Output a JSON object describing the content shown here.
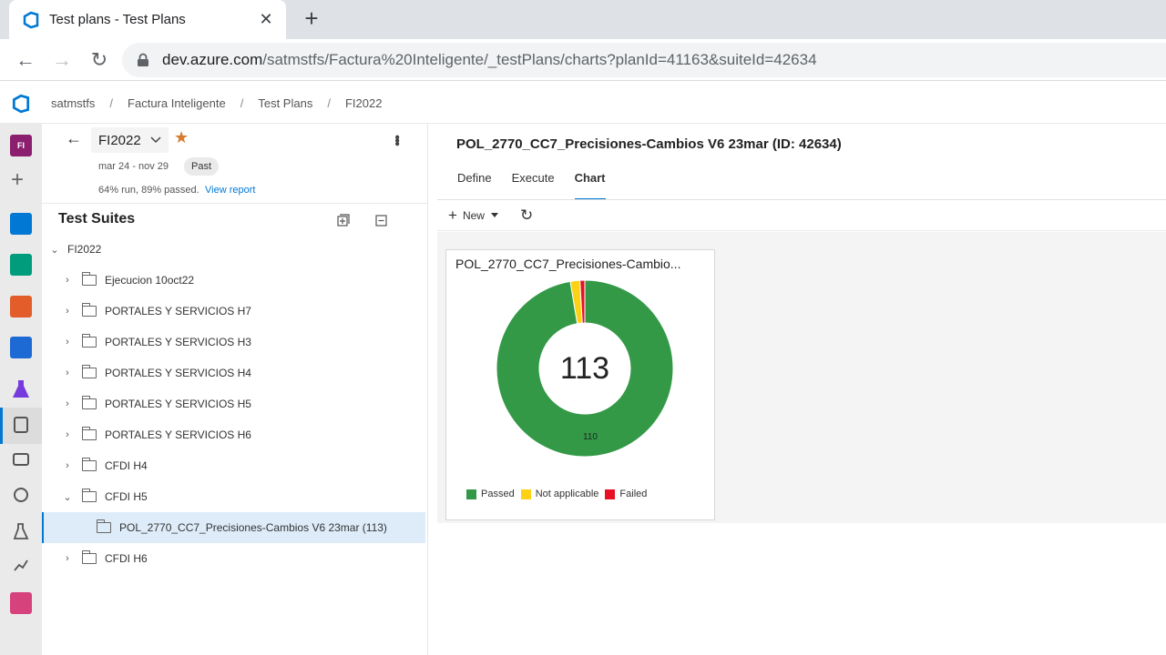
{
  "browser": {
    "tab_title": "Test plans - Test Plans",
    "url_host": "dev.azure.com",
    "url_path": "/satmstfs/Factura%20Inteligente/_testPlans/charts?planId=41163&suiteId=42634"
  },
  "breadcrumb": [
    "satmstfs",
    "Factura Inteligente",
    "Test Plans",
    "FI2022"
  ],
  "leftnav": {
    "project_initials": "FI"
  },
  "plan": {
    "name": "FI2022",
    "dates": "mar 24 - nov 29",
    "status_badge": "Past",
    "summary": "64% run, 89% passed.",
    "report_link": "View report"
  },
  "suites": {
    "title": "Test Suites",
    "root": "FI2022",
    "items": [
      "Ejecucion 10oct22",
      "PORTALES Y SERVICIOS H7",
      "PORTALES Y SERVICIOS H3",
      "PORTALES Y SERVICIOS H4",
      "PORTALES Y SERVICIOS H5",
      "PORTALES Y SERVICIOS H6",
      "CFDI H4",
      "CFDI H5",
      "POL_2770_CC7_Precisiones-Cambios V6 23mar (113)",
      "CFDI H6"
    ]
  },
  "main": {
    "title": "POL_2770_CC7_Precisiones-Cambios V6 23mar (ID: 42634)",
    "tabs": [
      "Define",
      "Execute",
      "Chart"
    ],
    "new_label": "New"
  },
  "colors": {
    "passed": "#339947",
    "not_applicable": "#fcd116",
    "failed": "#e81123",
    "accent": "#0078d4"
  },
  "chart_data": {
    "type": "pie",
    "title": "POL_2770_CC7_Precisiones-Cambio...",
    "total_label": "113",
    "categories": [
      "Passed",
      "Not applicable",
      "Failed"
    ],
    "values": [
      110,
      2,
      1
    ],
    "slice_labels": [
      "110",
      "",
      ""
    ]
  }
}
